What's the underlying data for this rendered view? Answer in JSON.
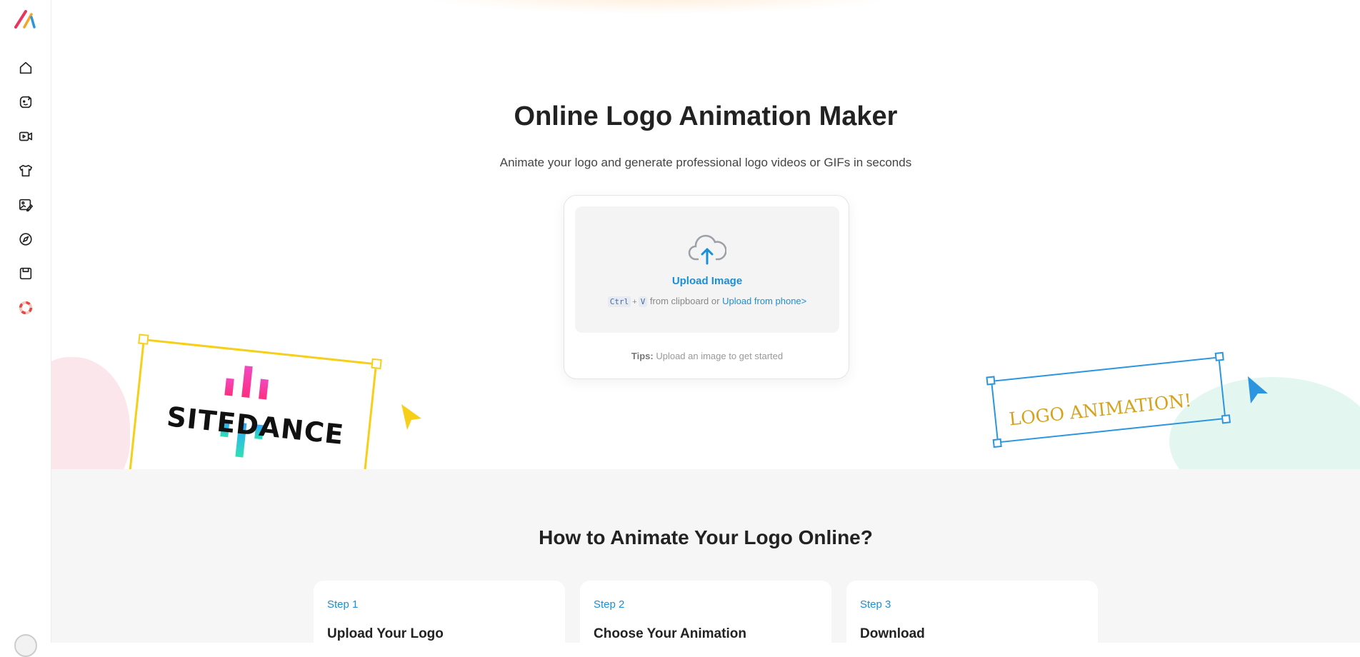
{
  "hero": {
    "title": "Online Logo Animation Maker",
    "subtitle": "Animate your logo and generate professional logo videos or GIFs in seconds"
  },
  "upload": {
    "label": "Upload Image",
    "kbd_ctrl": "Ctrl",
    "kbd_plus": "+",
    "kbd_v": "V",
    "hint_text": " from clipboard or ",
    "phone_link": "Upload from phone>",
    "tips_label": "Tips:",
    "tips_text": " Upload an image to get started"
  },
  "decorations": {
    "sitedance_logo": "SITEDANCE",
    "animation_text": "LOGO ANIMATION!"
  },
  "how_to": {
    "title": "How to Animate Your Logo Online?",
    "steps": [
      {
        "num": "Step 1",
        "name": "Upload Your Logo"
      },
      {
        "num": "Step 2",
        "name": "Choose Your Animation"
      },
      {
        "num": "Step 3",
        "name": "Download"
      }
    ]
  },
  "sidebar": {
    "icons": [
      "home-icon",
      "ai-face-icon",
      "video-icon",
      "tshirt-icon",
      "image-edit-icon",
      "compass-icon",
      "save-icon",
      "help-ring-icon"
    ]
  },
  "colors": {
    "accent": "#1a8fd6",
    "yellow": "#f6cf18",
    "blue_frame": "#2b95e0"
  }
}
